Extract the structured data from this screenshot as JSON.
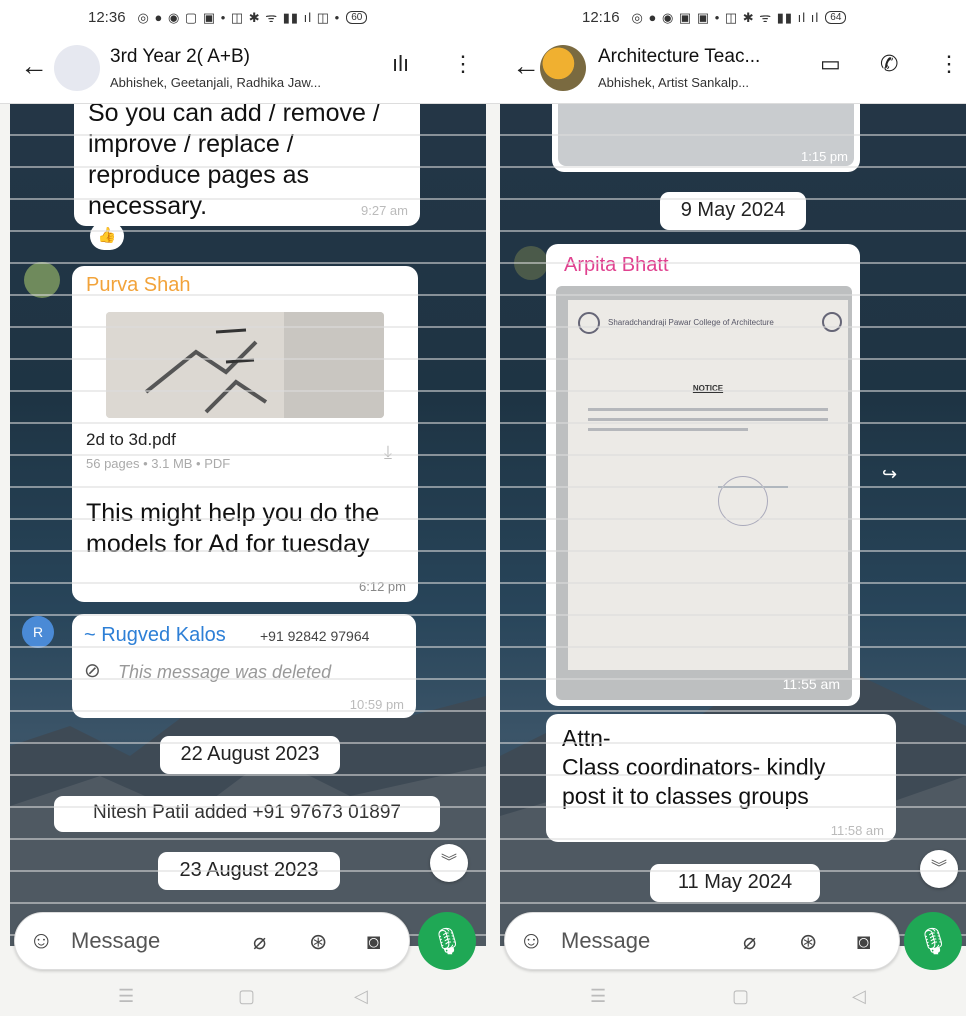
{
  "left": {
    "status": {
      "time": "12:36",
      "icons": "◎ ● ◉ ▢ ▣ • ◫ ✱ ᯤ ▮▮ ıl ◫ •",
      "battery": "60"
    },
    "header": {
      "title": "3rd Year 2(            ​A+B)",
      "subtitle": "Abhishek, Geetanjali, Radhika Jaw..."
    },
    "messages": {
      "m1_text": "So you can add / remove /\nimprove / replace /\nreproduce pages as\nnecessary.",
      "m1_time": "9:27 am",
      "m1_reaction": "👍",
      "m2_sender": "Purva Shah",
      "m2_file_name": "2d to 3d.pdf",
      "m2_file_meta": "56 pages • 3.1 MB • PDF",
      "m2_text": "This might help you do the\nmodels for Ad for tuesday",
      "m2_time": "6:12 pm",
      "m3_avatar": "R",
      "m3_sender": "~ Rugved Kalos",
      "m3_phone": "+91 92842 97964",
      "m3_text": "This message was deleted",
      "m3_time": "10:59 pm"
    },
    "date1": "22 August 2023",
    "system": "Nitesh Patil added +91 97673 01897",
    "date2": "23 August 2023",
    "composer": {
      "placeholder": "Message"
    }
  },
  "right": {
    "status": {
      "time": "12:16",
      "icons": "◎ ● ◉ ▣ ▣ • ◫ ✱ ᯤ ▮▮ ıl ıl",
      "battery": "64"
    },
    "header": {
      "title": "Architecture Teac...",
      "subtitle": "Abhishek, Artist Sankalp..."
    },
    "messages": {
      "r0_time": "1:15 pm",
      "date_a": "9 May 2024",
      "r1_sender": "Arpita Bhatt",
      "notice_title": "NOTICE",
      "notice_college": "Sharadchandraji Pawar College of Architecture",
      "r1_time": "11:55 am",
      "r2_text": "Attn-\nClass coordinators- kindly\npost it to classes groups",
      "r2_time": "11:58 am",
      "date_b": "11 May 2024"
    },
    "composer": {
      "placeholder": "Message"
    }
  },
  "colors": {
    "accent_green": "#1fa855",
    "sender_orange": "#f2a33a",
    "sender_pink": "#e0428f",
    "sender_blue": "#2d7fd6"
  }
}
